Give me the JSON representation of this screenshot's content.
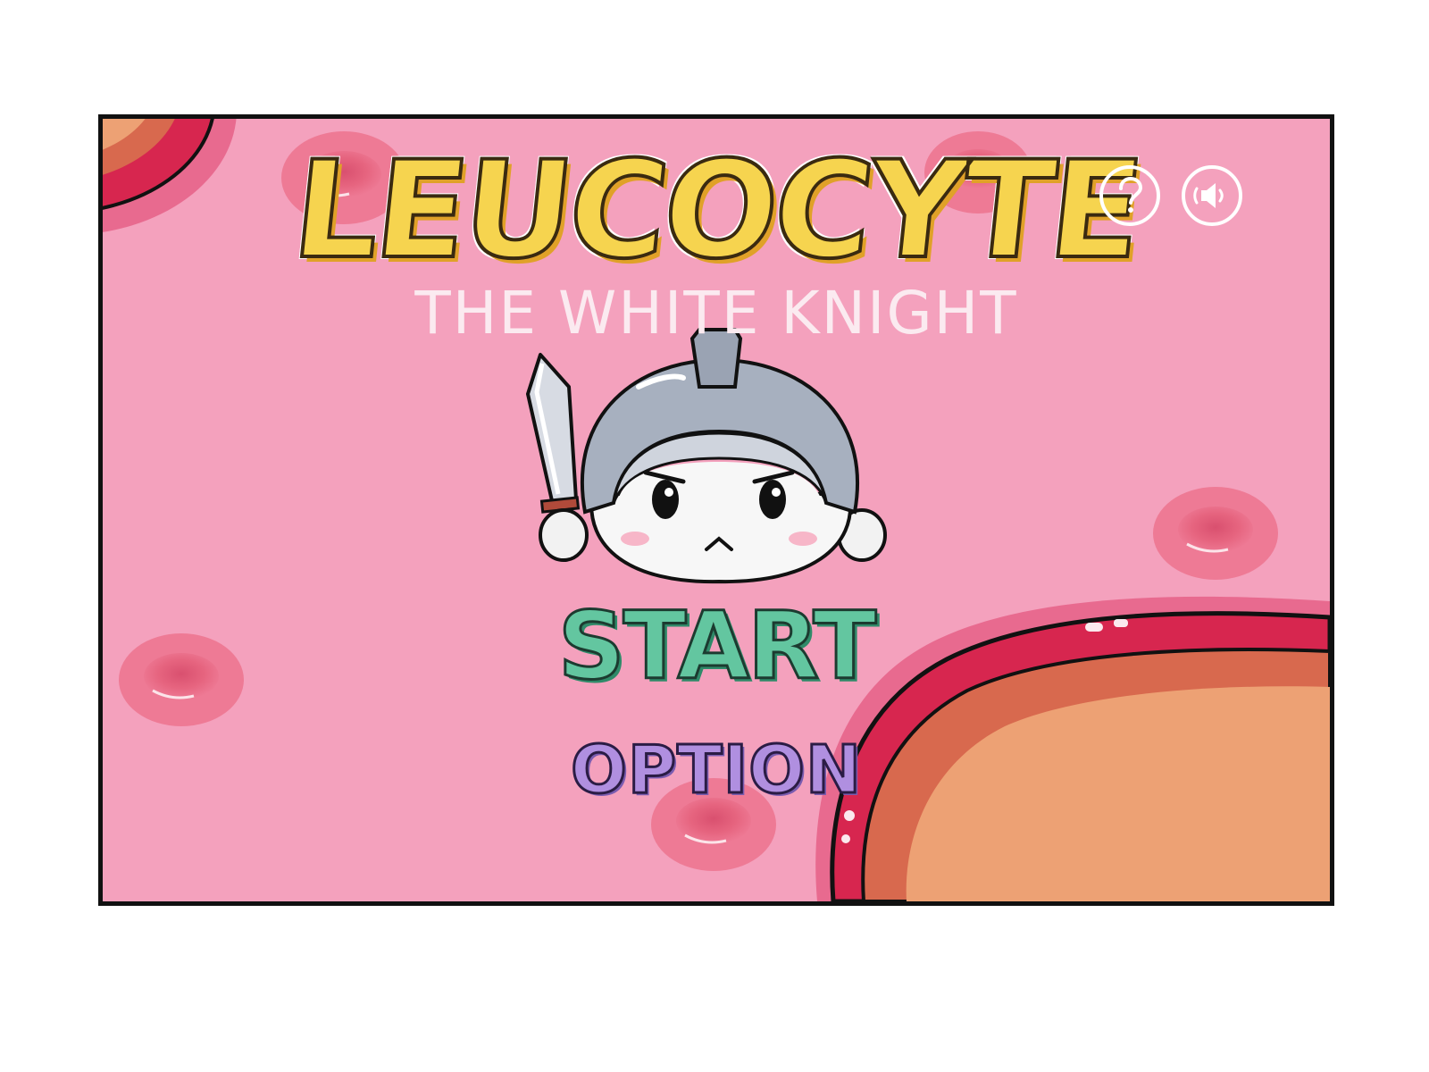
{
  "title": "LEUCOCYTE",
  "subtitle": "THE WHITE KNIGHT",
  "menu": {
    "start_label": "START",
    "option_label": "OPTION"
  },
  "top_right_controls": {
    "help_icon": "question-mark-icon",
    "sound_icon": "speaker-icon"
  },
  "colors": {
    "background": "#f4a1bd",
    "title": "#f6d44f",
    "start": "#63c6a0",
    "option": "#b08fe0",
    "blood_cell": "#e96689",
    "cell_membrane": "#d7264f",
    "cell_nucleus": "#eda174"
  }
}
